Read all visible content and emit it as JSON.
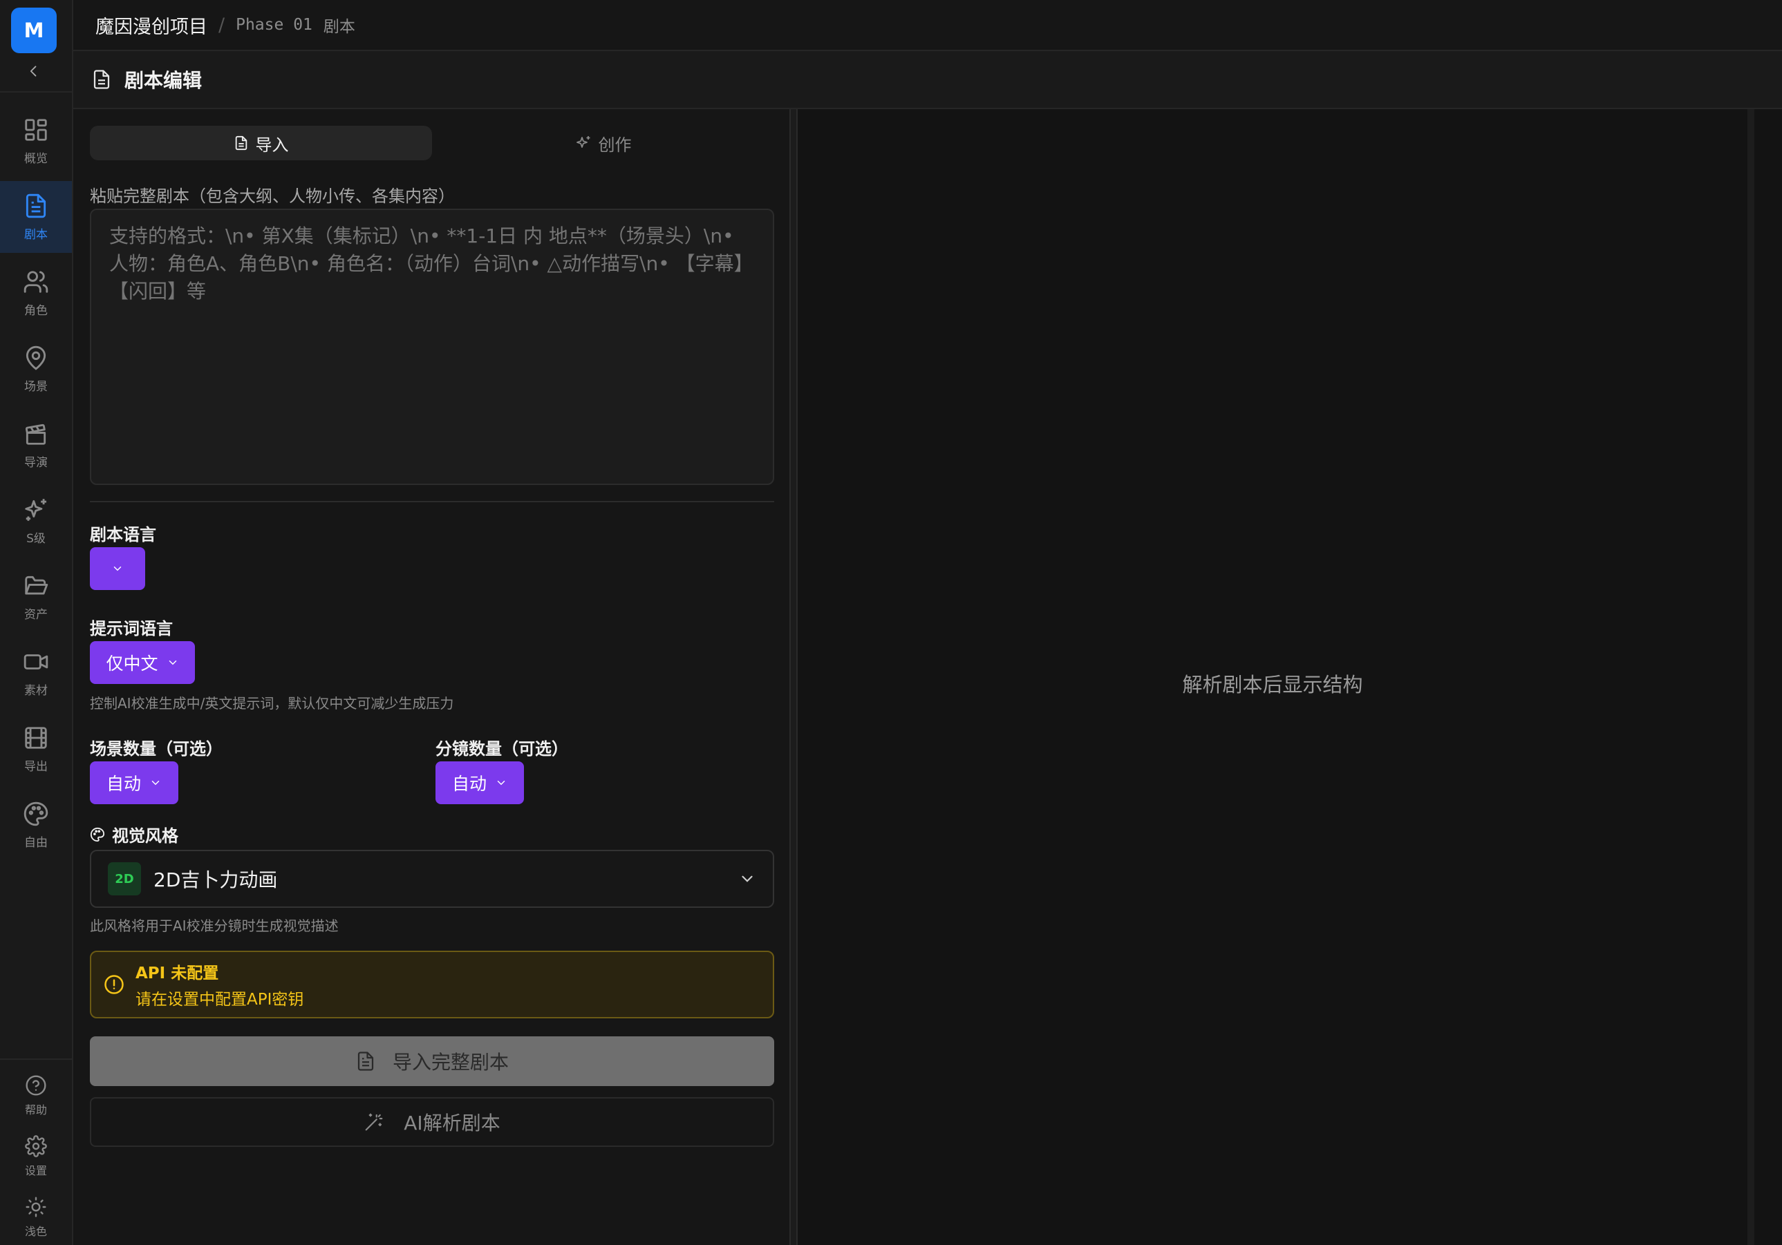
{
  "app": {
    "logo_letter": "M",
    "project_title": "魔因漫创项目",
    "breadcrumb_sep": "/",
    "phase": "Phase 01",
    "page": "剧本"
  },
  "sidebar": {
    "items": [
      {
        "label": "概览",
        "icon": "grid-icon"
      },
      {
        "label": "剧本",
        "icon": "document-icon",
        "active": true
      },
      {
        "label": "角色",
        "icon": "users-icon"
      },
      {
        "label": "场景",
        "icon": "map-pin-icon"
      },
      {
        "label": "导演",
        "icon": "clapperboard-icon"
      },
      {
        "label": "S级",
        "icon": "sparkles-icon"
      },
      {
        "label": "资产",
        "icon": "folder-icon"
      },
      {
        "label": "素材",
        "icon": "video-icon"
      },
      {
        "label": "导出",
        "icon": "film-icon"
      },
      {
        "label": "自由",
        "icon": "palette-icon"
      }
    ],
    "footer": [
      {
        "label": "帮助",
        "icon": "help-icon"
      },
      {
        "label": "设置",
        "icon": "gear-icon"
      },
      {
        "label": "浅色",
        "icon": "sun-icon"
      }
    ]
  },
  "section": {
    "title": "剧本编辑"
  },
  "tabs": {
    "import": "导入",
    "create": "创作"
  },
  "editor": {
    "label": "粘贴完整剧本（包含大纲、人物小传、各集内容）",
    "placeholder": "支持的格式：\\n• 第X集（集标记）\\n• **1-1日 内 地点**（场景头）\\n• 人物：角色A、角色B\\n• 角色名：（动作）台词\\n• △动作描写\\n• 【字幕】【闪回】等"
  },
  "form": {
    "script_language_label": "剧本语言",
    "prompt_language_label": "提示词语言",
    "prompt_language_value": "仅中文",
    "prompt_language_hint": "控制AI校准生成中/英文提示词，默认仅中文可减少生成压力",
    "scene_count_label": "场景数量（可选）",
    "scene_count_value": "自动",
    "shot_count_label": "分镜数量（可选）",
    "shot_count_value": "自动",
    "visual_style_label": "视觉风格",
    "visual_style_badge": "2D",
    "visual_style_value": "2D吉卜力动画",
    "visual_style_hint": "此风格将用于AI校准分镜时生成视觉描述"
  },
  "warning": {
    "title": "API 未配置",
    "message": "请在设置中配置API密钥"
  },
  "buttons": {
    "import": "导入完整剧本",
    "ai_parse": "AI解析剧本"
  },
  "right_panel": {
    "empty_message": "解析剧本后显示结构"
  },
  "colors": {
    "accent": "#7c3aed",
    "active_nav": "#2f86f6",
    "logo": "#1877f2",
    "warning": "#f5c518"
  }
}
